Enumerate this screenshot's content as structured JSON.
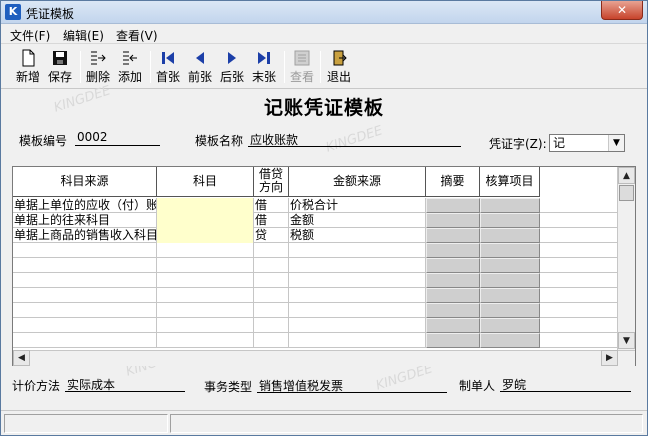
{
  "window": {
    "title": "凭证模板",
    "app_icon": "K",
    "close_label": "✕"
  },
  "menu": [
    {
      "label": "文件(F)"
    },
    {
      "label": "编辑(E)"
    },
    {
      "label": "查看(V)"
    }
  ],
  "toolbar": [
    {
      "label": "新增",
      "icon": "new-doc-icon",
      "enabled": true
    },
    {
      "label": "保存",
      "icon": "save-icon",
      "enabled": true
    },
    {
      "label": "删除",
      "icon": "delete-row-icon",
      "enabled": true
    },
    {
      "label": "添加",
      "icon": "add-row-icon",
      "enabled": true
    },
    {
      "label": "首张",
      "icon": "first-icon",
      "enabled": true
    },
    {
      "label": "前张",
      "icon": "prev-icon",
      "enabled": true
    },
    {
      "label": "后张",
      "icon": "next-icon",
      "enabled": true
    },
    {
      "label": "末张",
      "icon": "last-icon",
      "enabled": true
    },
    {
      "label": "查看",
      "icon": "view-icon",
      "enabled": false
    },
    {
      "label": "退出",
      "icon": "exit-icon",
      "enabled": true
    }
  ],
  "form": {
    "title": "记账凭证模板",
    "template_no_label": "模板编号",
    "template_no": "0002",
    "template_name_label": "模板名称",
    "template_name": "应收账款",
    "voucher_word_label": "凭证字(Z):",
    "voucher_word": "记"
  },
  "grid": {
    "headers": {
      "source": "科目来源",
      "subject": "科目",
      "dc_line1": "借贷",
      "dc_line2": "方向",
      "amount_source": "金额来源",
      "summary": "摘要",
      "accounting_item": "核算项目"
    },
    "rows": [
      {
        "source": "单据上单位的应收（付）账",
        "subject": "",
        "dc": "借",
        "amount_source": "价税合计"
      },
      {
        "source": "单据上的往来科目",
        "subject": "",
        "dc": "借",
        "amount_source": "金额"
      },
      {
        "source": "单据上商品的销售收入科目",
        "subject": "",
        "dc": "贷",
        "amount_source": "税额"
      },
      {
        "source": "",
        "subject": "",
        "dc": "",
        "amount_source": ""
      },
      {
        "source": "",
        "subject": "",
        "dc": "",
        "amount_source": ""
      },
      {
        "source": "",
        "subject": "",
        "dc": "",
        "amount_source": ""
      },
      {
        "source": "",
        "subject": "",
        "dc": "",
        "amount_source": ""
      },
      {
        "source": "",
        "subject": "",
        "dc": "",
        "amount_source": ""
      },
      {
        "source": "",
        "subject": "",
        "dc": "",
        "amount_source": ""
      },
      {
        "source": "",
        "subject": "",
        "dc": "",
        "amount_source": ""
      }
    ]
  },
  "footer": {
    "pricing_label": "计价方法",
    "pricing_value": "实际成本",
    "business_label": "事务类型",
    "business_value": "销售增值税发票",
    "maker_label": "制单人",
    "maker_value": "罗皖"
  },
  "watermark": "KINGDEE"
}
